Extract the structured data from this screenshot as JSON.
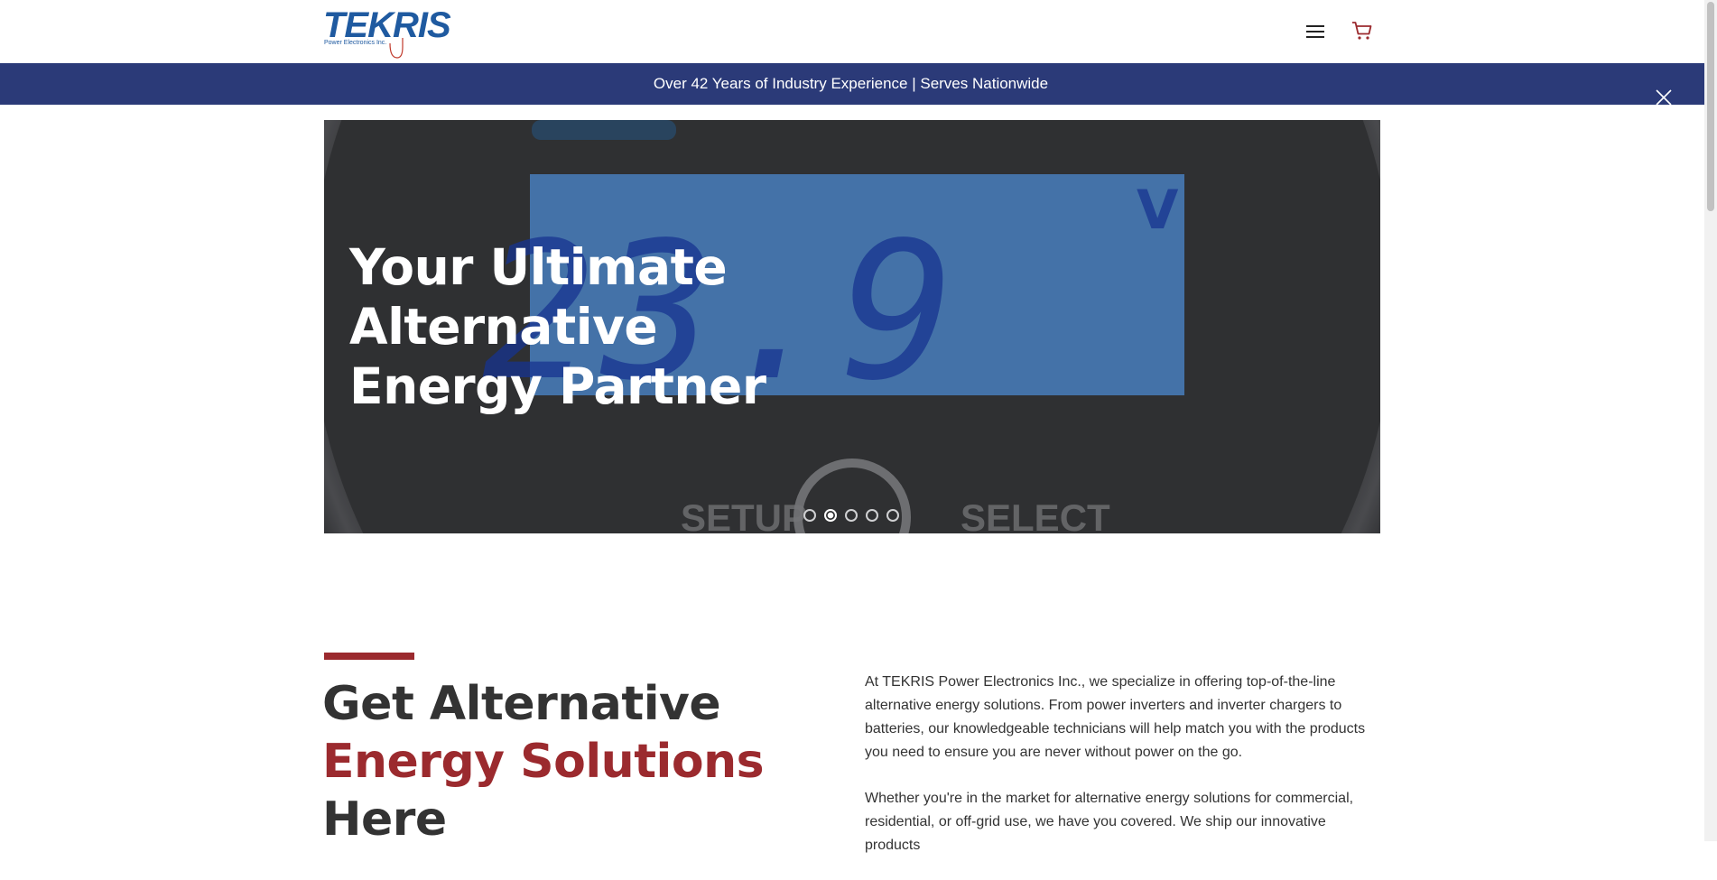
{
  "header": {
    "logo_text": "TEKRIS",
    "logo_subtext": "Power Electronics Inc.",
    "menu_icon": "hamburger-menu-icon",
    "cart_icon": "shopping-cart-icon"
  },
  "announcement": {
    "text": "Over 42 Years of Industry Experience | Serves Nationwide",
    "close_icon": "close-icon"
  },
  "hero": {
    "title_lines": [
      "Your Ultimate",
      "Alternative",
      "Energy Partner"
    ],
    "display_reading": "23.9",
    "display_unit": "V",
    "button_labels": [
      "SETUP",
      "SELECT"
    ],
    "slide_count": 5,
    "active_slide": 2
  },
  "intro": {
    "heading_line1": "Get Alternative",
    "heading_line2": "Energy Solutions",
    "heading_line3": "Here",
    "paragraph1": "At TEKRIS Power Electronics Inc., we specialize in offering top-of-the-line alternative energy solutions. From power inverters and inverter chargers to batteries, our knowledgeable technicians will help match you with the products you need to ensure you are never without power on the go.",
    "paragraph2": "Whether you're in the market for alternative energy solutions for commercial, residential, or off-grid use, we have you covered. We ship our innovative products"
  },
  "colors": {
    "brand_blue": "#1f5aa0",
    "announce_bg": "#2b3a78",
    "accent_red": "#9b2a2e",
    "text_dark": "#333333"
  }
}
